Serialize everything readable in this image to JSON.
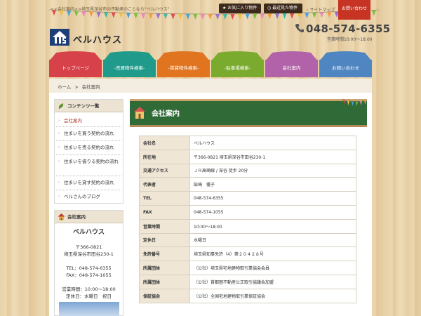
{
  "top": {
    "tagline": "<<会社案内>>埼玉県深谷市の不動産のことなら\"ベルハウス\"",
    "favorites_label": "お気に入り物件",
    "recent_label": "最近見た物件",
    "sitemap_label": "サイトマップ",
    "contact_label": "お問い合わせ"
  },
  "header": {
    "logo_text": "ベルハウス",
    "phone": "048-574-6355",
    "hours": "営業時間10:00～18:00"
  },
  "nav": [
    {
      "label": "トップページ",
      "color": "#d6414a"
    },
    {
      "label": "-売買物件検索-",
      "color": "#1f9a8b"
    },
    {
      "label": "-賃貸物件検索-",
      "color": "#e0741f"
    },
    {
      "label": "-駐車場検索-",
      "color": "#7bab2e"
    },
    {
      "label": "会社案内",
      "color": "#b262a8"
    },
    {
      "label": "お問い合わせ",
      "color": "#4f86c2"
    }
  ],
  "breadcrumb": {
    "home": "ホーム",
    "separator": ">",
    "current": "会社案内"
  },
  "sidebar": {
    "menu_title": "コンテンツ一覧",
    "menu_items": [
      "会社案内",
      "住まいを買う契約の流れ",
      "住まいを売る契約の流れ",
      "住まいを借りる契約の流れ",
      "住まいを貸す契約の流れ",
      "ベルさんのブログ"
    ],
    "company_title": "会社案内",
    "company_name": "ベルハウス",
    "postal": "〒366-0821",
    "address": "埼玉県深谷市田谷230-1",
    "tel": "TEL：048-574-6355",
    "fax": "FAX：048-574-1055",
    "hours": "営業時間：10:00～18:00",
    "holiday": "定休日：水曜日　祝日"
  },
  "content": {
    "title": "会社案内",
    "rows": [
      {
        "label": "会社名",
        "value": "ベルハウス"
      },
      {
        "label": "所在地",
        "value": "〒366-0821 埼玉県深谷市田谷230-1"
      },
      {
        "label": "交通アクセス",
        "value": "ＪＲ高崎線 / 深谷 徒歩 20分"
      },
      {
        "label": "代表者",
        "value": "柴崎　優子"
      },
      {
        "label": "TEL",
        "value": "048-574-6355"
      },
      {
        "label": "FAX",
        "value": "048-574-1055"
      },
      {
        "label": "営業時間",
        "value": "10:00～18:00"
      },
      {
        "label": "定休日",
        "value": "水曜日"
      },
      {
        "label": "免許番号",
        "value": "埼玉県知事免許（4）第２０４２８号"
      },
      {
        "label": "所属団体",
        "value": "（公社）埼玉県宅地建物取引業協会会員"
      },
      {
        "label": "所属団体",
        "value": "（公社）首都圏不動産公正取引協議会加盟"
      },
      {
        "label": "保証協会",
        "value": "（公社）全国宅地建物取引業保証協会"
      }
    ]
  }
}
